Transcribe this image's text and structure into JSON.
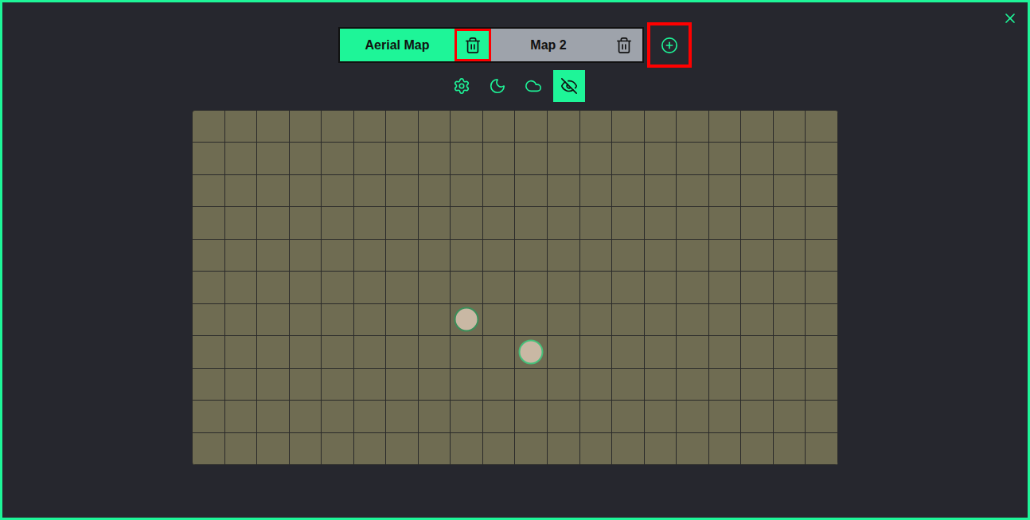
{
  "tabs": [
    {
      "label": "Aerial Map",
      "selected": true,
      "delete_highlighted": true
    },
    {
      "label": "Map 2",
      "selected": false,
      "delete_highlighted": false
    }
  ],
  "add_button": {
    "highlighted": true
  },
  "tools": [
    {
      "kind": "settings",
      "selected": false
    },
    {
      "kind": "fog",
      "selected": false
    },
    {
      "kind": "weather",
      "selected": false
    },
    {
      "kind": "hide",
      "selected": true
    }
  ],
  "map": {
    "grid": {
      "columns": 20,
      "rows": 11
    },
    "tokens": [
      {
        "color": "#3b8f5a"
      },
      {
        "color": "#46c07a"
      }
    ]
  }
}
